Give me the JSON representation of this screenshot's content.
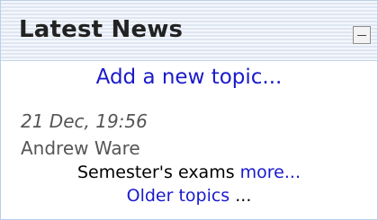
{
  "block": {
    "title": "Latest News",
    "collapse_icon": "minus-icon",
    "add_topic": "Add a new topic...",
    "post": {
      "date": "21 Dec, 19:56",
      "author": "Andrew Ware",
      "subject": "Semester's exams",
      "more": "more..."
    },
    "older_topics": "Older topics",
    "older_suffix": "..."
  },
  "colors": {
    "link": "#1a1acc",
    "header_bg": "#e8eef8",
    "border": "#b9cfe6"
  }
}
